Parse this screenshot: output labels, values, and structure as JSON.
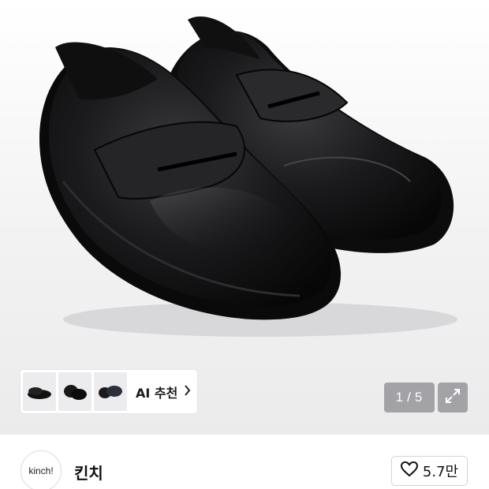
{
  "gallery": {
    "counter_current": "1",
    "counter_separator": "/",
    "counter_total": "5",
    "expand_icon": "expand-arrows-icon"
  },
  "ai_recommend": {
    "label": "AI 추천",
    "chevron_icon": "chevron-right-icon",
    "thumbnail_count": 3
  },
  "shop": {
    "logo_text": "kinch!",
    "name": "킨치"
  },
  "like": {
    "icon": "heart-outline-icon",
    "count": "5.7만"
  },
  "colors": {
    "accent": "#111111",
    "overlay": "#87878c"
  }
}
